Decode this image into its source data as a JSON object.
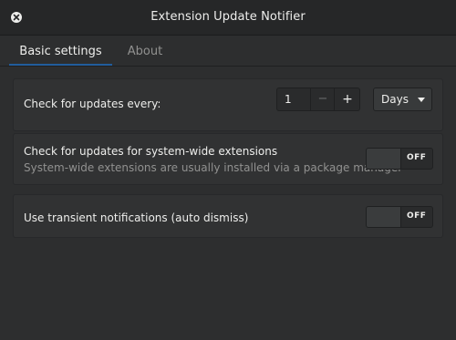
{
  "window": {
    "title": "Extension Update Notifier"
  },
  "tabs": [
    {
      "label": "Basic settings",
      "active": true
    },
    {
      "label": "About",
      "active": false
    }
  ],
  "settings": {
    "check_every": {
      "label": "Check for updates every:",
      "value": "1",
      "minus": "−",
      "plus": "+",
      "unit": "Days"
    },
    "system_wide": {
      "label": "Check for updates for system-wide extensions",
      "sublabel": "System-wide extensions are usually installed via a package manager",
      "state": "OFF"
    },
    "transient": {
      "label": "Use transient notifications (auto dismiss)",
      "state": "OFF"
    }
  },
  "colors": {
    "accent": "#215d9c",
    "background": "#2d2e2f"
  }
}
